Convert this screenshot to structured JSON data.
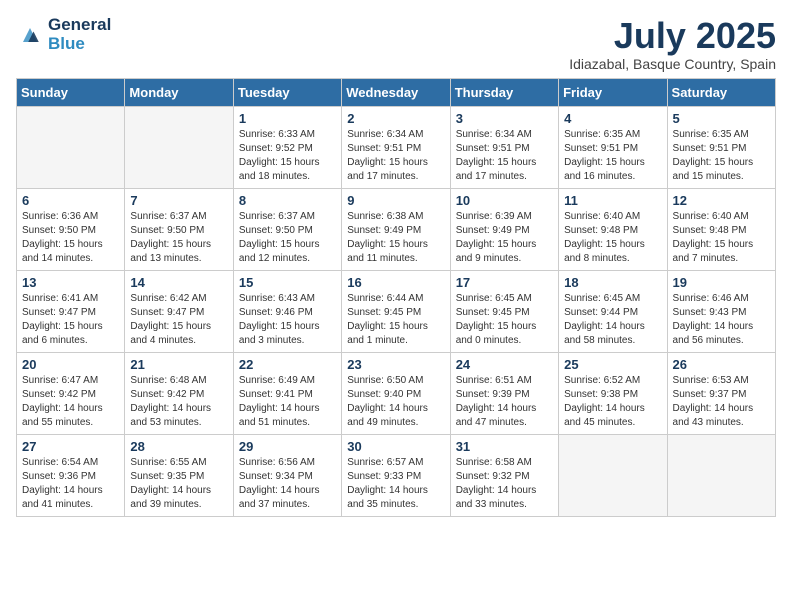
{
  "header": {
    "logo_line1": "General",
    "logo_line2": "Blue",
    "month": "July 2025",
    "location": "Idiazabal, Basque Country, Spain"
  },
  "days_of_week": [
    "Sunday",
    "Monday",
    "Tuesday",
    "Wednesday",
    "Thursday",
    "Friday",
    "Saturday"
  ],
  "weeks": [
    [
      {
        "day": "",
        "info": ""
      },
      {
        "day": "",
        "info": ""
      },
      {
        "day": "1",
        "info": "Sunrise: 6:33 AM\nSunset: 9:52 PM\nDaylight: 15 hours\nand 18 minutes."
      },
      {
        "day": "2",
        "info": "Sunrise: 6:34 AM\nSunset: 9:51 PM\nDaylight: 15 hours\nand 17 minutes."
      },
      {
        "day": "3",
        "info": "Sunrise: 6:34 AM\nSunset: 9:51 PM\nDaylight: 15 hours\nand 17 minutes."
      },
      {
        "day": "4",
        "info": "Sunrise: 6:35 AM\nSunset: 9:51 PM\nDaylight: 15 hours\nand 16 minutes."
      },
      {
        "day": "5",
        "info": "Sunrise: 6:35 AM\nSunset: 9:51 PM\nDaylight: 15 hours\nand 15 minutes."
      }
    ],
    [
      {
        "day": "6",
        "info": "Sunrise: 6:36 AM\nSunset: 9:50 PM\nDaylight: 15 hours\nand 14 minutes."
      },
      {
        "day": "7",
        "info": "Sunrise: 6:37 AM\nSunset: 9:50 PM\nDaylight: 15 hours\nand 13 minutes."
      },
      {
        "day": "8",
        "info": "Sunrise: 6:37 AM\nSunset: 9:50 PM\nDaylight: 15 hours\nand 12 minutes."
      },
      {
        "day": "9",
        "info": "Sunrise: 6:38 AM\nSunset: 9:49 PM\nDaylight: 15 hours\nand 11 minutes."
      },
      {
        "day": "10",
        "info": "Sunrise: 6:39 AM\nSunset: 9:49 PM\nDaylight: 15 hours\nand 9 minutes."
      },
      {
        "day": "11",
        "info": "Sunrise: 6:40 AM\nSunset: 9:48 PM\nDaylight: 15 hours\nand 8 minutes."
      },
      {
        "day": "12",
        "info": "Sunrise: 6:40 AM\nSunset: 9:48 PM\nDaylight: 15 hours\nand 7 minutes."
      }
    ],
    [
      {
        "day": "13",
        "info": "Sunrise: 6:41 AM\nSunset: 9:47 PM\nDaylight: 15 hours\nand 6 minutes."
      },
      {
        "day": "14",
        "info": "Sunrise: 6:42 AM\nSunset: 9:47 PM\nDaylight: 15 hours\nand 4 minutes."
      },
      {
        "day": "15",
        "info": "Sunrise: 6:43 AM\nSunset: 9:46 PM\nDaylight: 15 hours\nand 3 minutes."
      },
      {
        "day": "16",
        "info": "Sunrise: 6:44 AM\nSunset: 9:45 PM\nDaylight: 15 hours\nand 1 minute."
      },
      {
        "day": "17",
        "info": "Sunrise: 6:45 AM\nSunset: 9:45 PM\nDaylight: 15 hours\nand 0 minutes."
      },
      {
        "day": "18",
        "info": "Sunrise: 6:45 AM\nSunset: 9:44 PM\nDaylight: 14 hours\nand 58 minutes."
      },
      {
        "day": "19",
        "info": "Sunrise: 6:46 AM\nSunset: 9:43 PM\nDaylight: 14 hours\nand 56 minutes."
      }
    ],
    [
      {
        "day": "20",
        "info": "Sunrise: 6:47 AM\nSunset: 9:42 PM\nDaylight: 14 hours\nand 55 minutes."
      },
      {
        "day": "21",
        "info": "Sunrise: 6:48 AM\nSunset: 9:42 PM\nDaylight: 14 hours\nand 53 minutes."
      },
      {
        "day": "22",
        "info": "Sunrise: 6:49 AM\nSunset: 9:41 PM\nDaylight: 14 hours\nand 51 minutes."
      },
      {
        "day": "23",
        "info": "Sunrise: 6:50 AM\nSunset: 9:40 PM\nDaylight: 14 hours\nand 49 minutes."
      },
      {
        "day": "24",
        "info": "Sunrise: 6:51 AM\nSunset: 9:39 PM\nDaylight: 14 hours\nand 47 minutes."
      },
      {
        "day": "25",
        "info": "Sunrise: 6:52 AM\nSunset: 9:38 PM\nDaylight: 14 hours\nand 45 minutes."
      },
      {
        "day": "26",
        "info": "Sunrise: 6:53 AM\nSunset: 9:37 PM\nDaylight: 14 hours\nand 43 minutes."
      }
    ],
    [
      {
        "day": "27",
        "info": "Sunrise: 6:54 AM\nSunset: 9:36 PM\nDaylight: 14 hours\nand 41 minutes."
      },
      {
        "day": "28",
        "info": "Sunrise: 6:55 AM\nSunset: 9:35 PM\nDaylight: 14 hours\nand 39 minutes."
      },
      {
        "day": "29",
        "info": "Sunrise: 6:56 AM\nSunset: 9:34 PM\nDaylight: 14 hours\nand 37 minutes."
      },
      {
        "day": "30",
        "info": "Sunrise: 6:57 AM\nSunset: 9:33 PM\nDaylight: 14 hours\nand 35 minutes."
      },
      {
        "day": "31",
        "info": "Sunrise: 6:58 AM\nSunset: 9:32 PM\nDaylight: 14 hours\nand 33 minutes."
      },
      {
        "day": "",
        "info": ""
      },
      {
        "day": "",
        "info": ""
      }
    ]
  ]
}
